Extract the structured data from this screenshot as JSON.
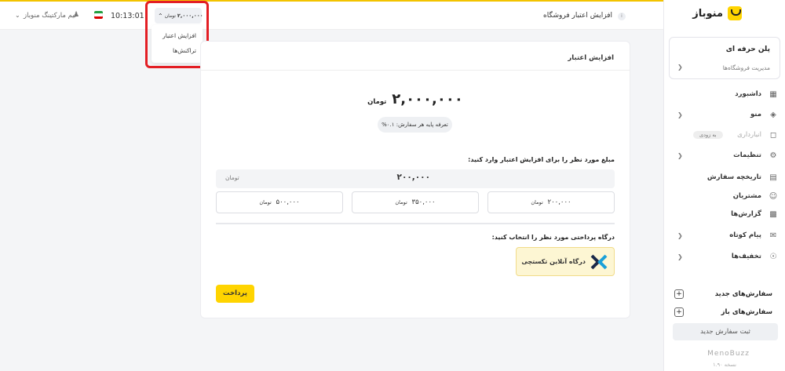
{
  "brand": {
    "name": "منوباز",
    "logo_color": "#FFD400"
  },
  "plan": {
    "title": "پلن حرفه ای",
    "subtitle": "مدیریت فروشگاه‌ها"
  },
  "sidebar": {
    "items": [
      {
        "label": "داشبورد",
        "icon": "dashboard-grid-icon"
      },
      {
        "label": "منو",
        "icon": "layers-icon",
        "chevron": true
      },
      {
        "label": "انبارداری",
        "icon": "box-icon",
        "muted": true,
        "badge": "به زودی"
      },
      {
        "label": "تنظیمات",
        "icon": "gear-icon",
        "chevron": true
      },
      {
        "label": "تاریخچه سفارش",
        "icon": "document-icon"
      },
      {
        "label": "مشتریان",
        "icon": "users-icon"
      },
      {
        "label": "گزارش‌ها",
        "icon": "report-icon"
      },
      {
        "label": "پیام کوتاه",
        "icon": "message-icon",
        "chevron": true
      },
      {
        "label": "تخفیف‌ها",
        "icon": "discount-icon",
        "chevron": true
      }
    ],
    "quick": [
      {
        "label": "سفارش‌های جدید"
      },
      {
        "label": "سفارش‌های باز"
      }
    ],
    "new_order_button": "ثبت سفارش جدید",
    "footer_brand": "MenoBuzz",
    "footer_version": "نسخه ۱.۹۰"
  },
  "topbar": {
    "page_title": "افزایش اعتبار فروشگاه",
    "user_name": "تیم مارکتینگ منوباز",
    "clock": "10:13:01",
    "credit_amount": "۲,۰۰۰,۰۰۰",
    "credit_unit": "تومان",
    "flag_colors": [
      "#239F40",
      "#FFFFFF",
      "#DA0000"
    ]
  },
  "dropdown": {
    "items": [
      "افزایش اعتبار",
      "تراکنش‌ها"
    ],
    "highlight_color": "#E31E24"
  },
  "card": {
    "title": "افزایش اعتبار",
    "amount": "۲,۰۰۰,۰۰۰",
    "amount_unit": "تومان",
    "rate_text": "تعرفه پایه هر سفارش: ۰.۱%",
    "prompt": "مبلغ مورد نظر را برای افزایش اعتبار وارد کنید:",
    "input_value": "۲۰۰,۰۰۰",
    "input_unit": "تومان",
    "presets": [
      {
        "value": "۲۰۰,۰۰۰",
        "unit": "تومان"
      },
      {
        "value": "۳۵۰,۰۰۰",
        "unit": "تومان"
      },
      {
        "value": "۵۰۰,۰۰۰",
        "unit": "تومان"
      }
    ],
    "gateway_prompt": "درگاه پرداختی مورد نظر را انتخاب کنید:",
    "gateway_name": "درگاه آنلاین تکستچی",
    "pay_button": "پرداخت",
    "accent_color": "#FFD400"
  }
}
